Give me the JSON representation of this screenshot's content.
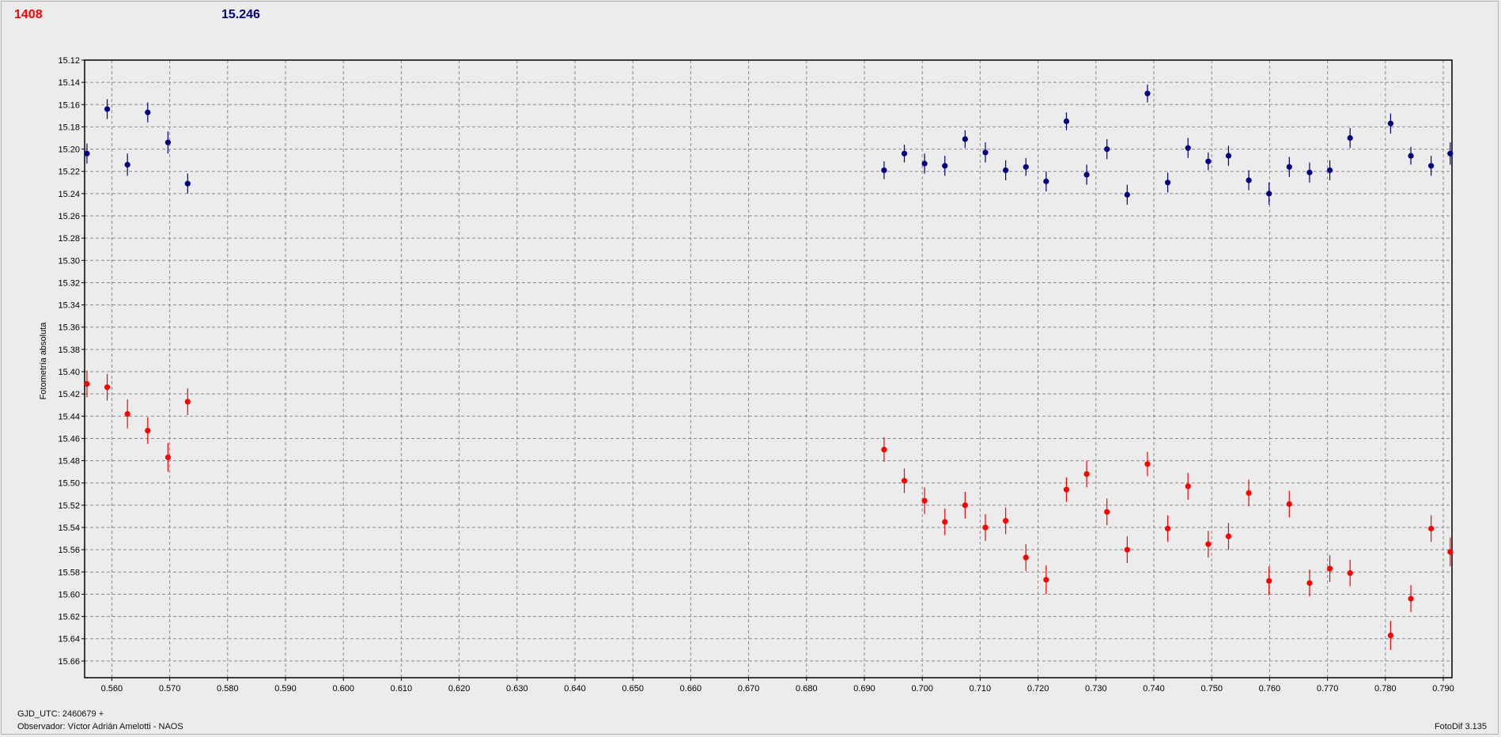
{
  "header": {
    "left_value": "1408",
    "left_color": "#ff0000",
    "right_value": "15.246",
    "right_color": "#000080"
  },
  "footer": {
    "jd_label": "GJD_UTC: 2460679 +",
    "observer": "Observador: Víctor Adrián Amelotti - NAOS",
    "version": "FotoDif 3.135"
  },
  "chart_data": {
    "type": "scatter",
    "title": "",
    "xlabel": "",
    "ylabel": "Fotometría absoluta",
    "xlim": [
      0.5553,
      0.7915
    ],
    "ylim": [
      15.12,
      15.675
    ],
    "y_inverted": true,
    "grid": true,
    "grid_style": "dashed",
    "x_ticks": [
      "0.560",
      "0.570",
      "0.580",
      "0.590",
      "0.600",
      "0.610",
      "0.620",
      "0.630",
      "0.640",
      "0.650",
      "0.660",
      "0.670",
      "0.680",
      "0.690",
      "0.700",
      "0.710",
      "0.720",
      "0.730",
      "0.740",
      "0.750",
      "0.760",
      "0.770",
      "0.780",
      "0.790"
    ],
    "y_ticks": [
      "15.12",
      "15.14",
      "15.16",
      "15.18",
      "15.20",
      "15.22",
      "15.24",
      "15.26",
      "15.28",
      "15.30",
      "15.32",
      "15.34",
      "15.36",
      "15.38",
      "15.40",
      "15.42",
      "15.44",
      "15.46",
      "15.48",
      "15.50",
      "15.52",
      "15.54",
      "15.56",
      "15.58",
      "15.60",
      "15.62",
      "15.64",
      "15.66"
    ],
    "series": [
      {
        "color": "#000080",
        "x": [
          0.5557,
          0.5592,
          0.5627,
          0.5662,
          0.5697,
          0.5731,
          0.6934,
          0.6969,
          0.7004,
          0.7039,
          0.7074,
          0.7109,
          0.7144,
          0.7179,
          0.7214,
          0.7249,
          0.7284,
          0.7319,
          0.7354,
          0.7389,
          0.7424,
          0.7459,
          0.7494,
          0.7529,
          0.7564,
          0.7599,
          0.7634,
          0.7669,
          0.7704,
          0.7739,
          0.7809,
          0.7844,
          0.7879,
          0.7912
        ],
        "y": [
          15.204,
          15.164,
          15.214,
          15.167,
          15.194,
          15.231,
          15.219,
          15.204,
          15.213,
          15.215,
          15.191,
          15.203,
          15.219,
          15.216,
          15.229,
          15.175,
          15.223,
          15.2,
          15.241,
          15.15,
          15.23,
          15.199,
          15.211,
          15.206,
          15.228,
          15.24,
          15.216,
          15.221,
          15.219,
          15.19,
          15.177,
          15.206,
          15.215,
          15.204
        ],
        "err": [
          0.009,
          0.009,
          0.01,
          0.009,
          0.01,
          0.009,
          0.008,
          0.008,
          0.009,
          0.009,
          0.008,
          0.009,
          0.009,
          0.008,
          0.009,
          0.008,
          0.009,
          0.009,
          0.009,
          0.008,
          0.009,
          0.009,
          0.008,
          0.009,
          0.009,
          0.01,
          0.009,
          0.009,
          0.009,
          0.009,
          0.009,
          0.008,
          0.009,
          0.01
        ]
      },
      {
        "color": "#ff0000",
        "x": [
          0.5557,
          0.5592,
          0.5627,
          0.5662,
          0.5697,
          0.5731,
          0.6934,
          0.6969,
          0.7004,
          0.7039,
          0.7074,
          0.7109,
          0.7144,
          0.7179,
          0.7214,
          0.7249,
          0.7284,
          0.7319,
          0.7354,
          0.7389,
          0.7424,
          0.7459,
          0.7494,
          0.7529,
          0.7564,
          0.7599,
          0.7634,
          0.7669,
          0.7704,
          0.7739,
          0.7809,
          0.7844,
          0.7879,
          0.7912
        ],
        "y": [
          15.411,
          15.414,
          15.438,
          15.453,
          15.477,
          15.427,
          15.47,
          15.498,
          15.516,
          15.535,
          15.52,
          15.54,
          15.534,
          15.567,
          15.587,
          15.506,
          15.492,
          15.526,
          15.56,
          15.483,
          15.541,
          15.503,
          15.555,
          15.548,
          15.509,
          15.588,
          15.519,
          15.59,
          15.577,
          15.581,
          15.637,
          15.604,
          15.541,
          15.562
        ],
        "err": [
          0.012,
          0.012,
          0.013,
          0.012,
          0.013,
          0.012,
          0.011,
          0.011,
          0.012,
          0.012,
          0.012,
          0.012,
          0.012,
          0.012,
          0.013,
          0.011,
          0.012,
          0.012,
          0.012,
          0.011,
          0.012,
          0.012,
          0.012,
          0.012,
          0.012,
          0.013,
          0.012,
          0.012,
          0.012,
          0.012,
          0.013,
          0.012,
          0.012,
          0.013
        ]
      }
    ]
  }
}
